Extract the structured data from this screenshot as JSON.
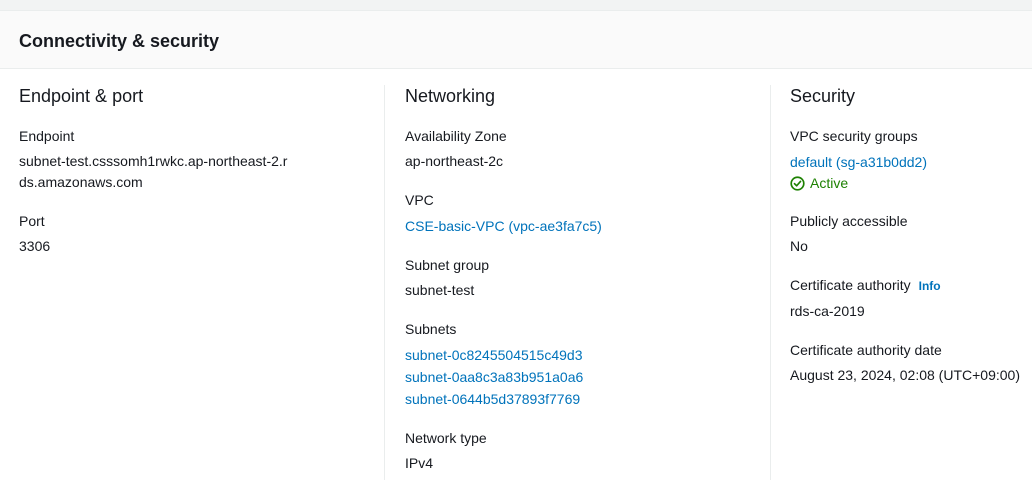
{
  "panel": {
    "title": "Connectivity & security"
  },
  "endpoint_port": {
    "title": "Endpoint & port",
    "endpoint_label": "Endpoint",
    "endpoint_value": "subnet-test.csssomh1rwkc.ap-northeast-2.rds.amazonaws.com",
    "port_label": "Port",
    "port_value": "3306"
  },
  "networking": {
    "title": "Networking",
    "az_label": "Availability Zone",
    "az_value": "ap-northeast-2c",
    "vpc_label": "VPC",
    "vpc_value": "CSE-basic-VPC (vpc-ae3fa7c5)",
    "subnet_group_label": "Subnet group",
    "subnet_group_value": "subnet-test",
    "subnets_label": "Subnets",
    "subnets": [
      "subnet-0c8245504515c49d3",
      "subnet-0aa8c3a83b951a0a6",
      "subnet-0644b5d37893f7769"
    ],
    "network_type_label": "Network type",
    "network_type_value": "IPv4"
  },
  "security": {
    "title": "Security",
    "vpc_sg_label": "VPC security groups",
    "vpc_sg_value": "default (sg-a31b0dd2)",
    "vpc_sg_status": "Active",
    "public_label": "Publicly accessible",
    "public_value": "No",
    "ca_label": "Certificate authority",
    "ca_info": "Info",
    "ca_value": "rds-ca-2019",
    "ca_date_label": "Certificate authority date",
    "ca_date_value": "August 23, 2024, 02:08 (UTC+09:00)"
  },
  "colors": {
    "link": "#0073bb",
    "success": "#1d8102",
    "text": "#16191f",
    "divider": "#eaeded"
  },
  "icons": {
    "status": "status-positive-icon"
  }
}
